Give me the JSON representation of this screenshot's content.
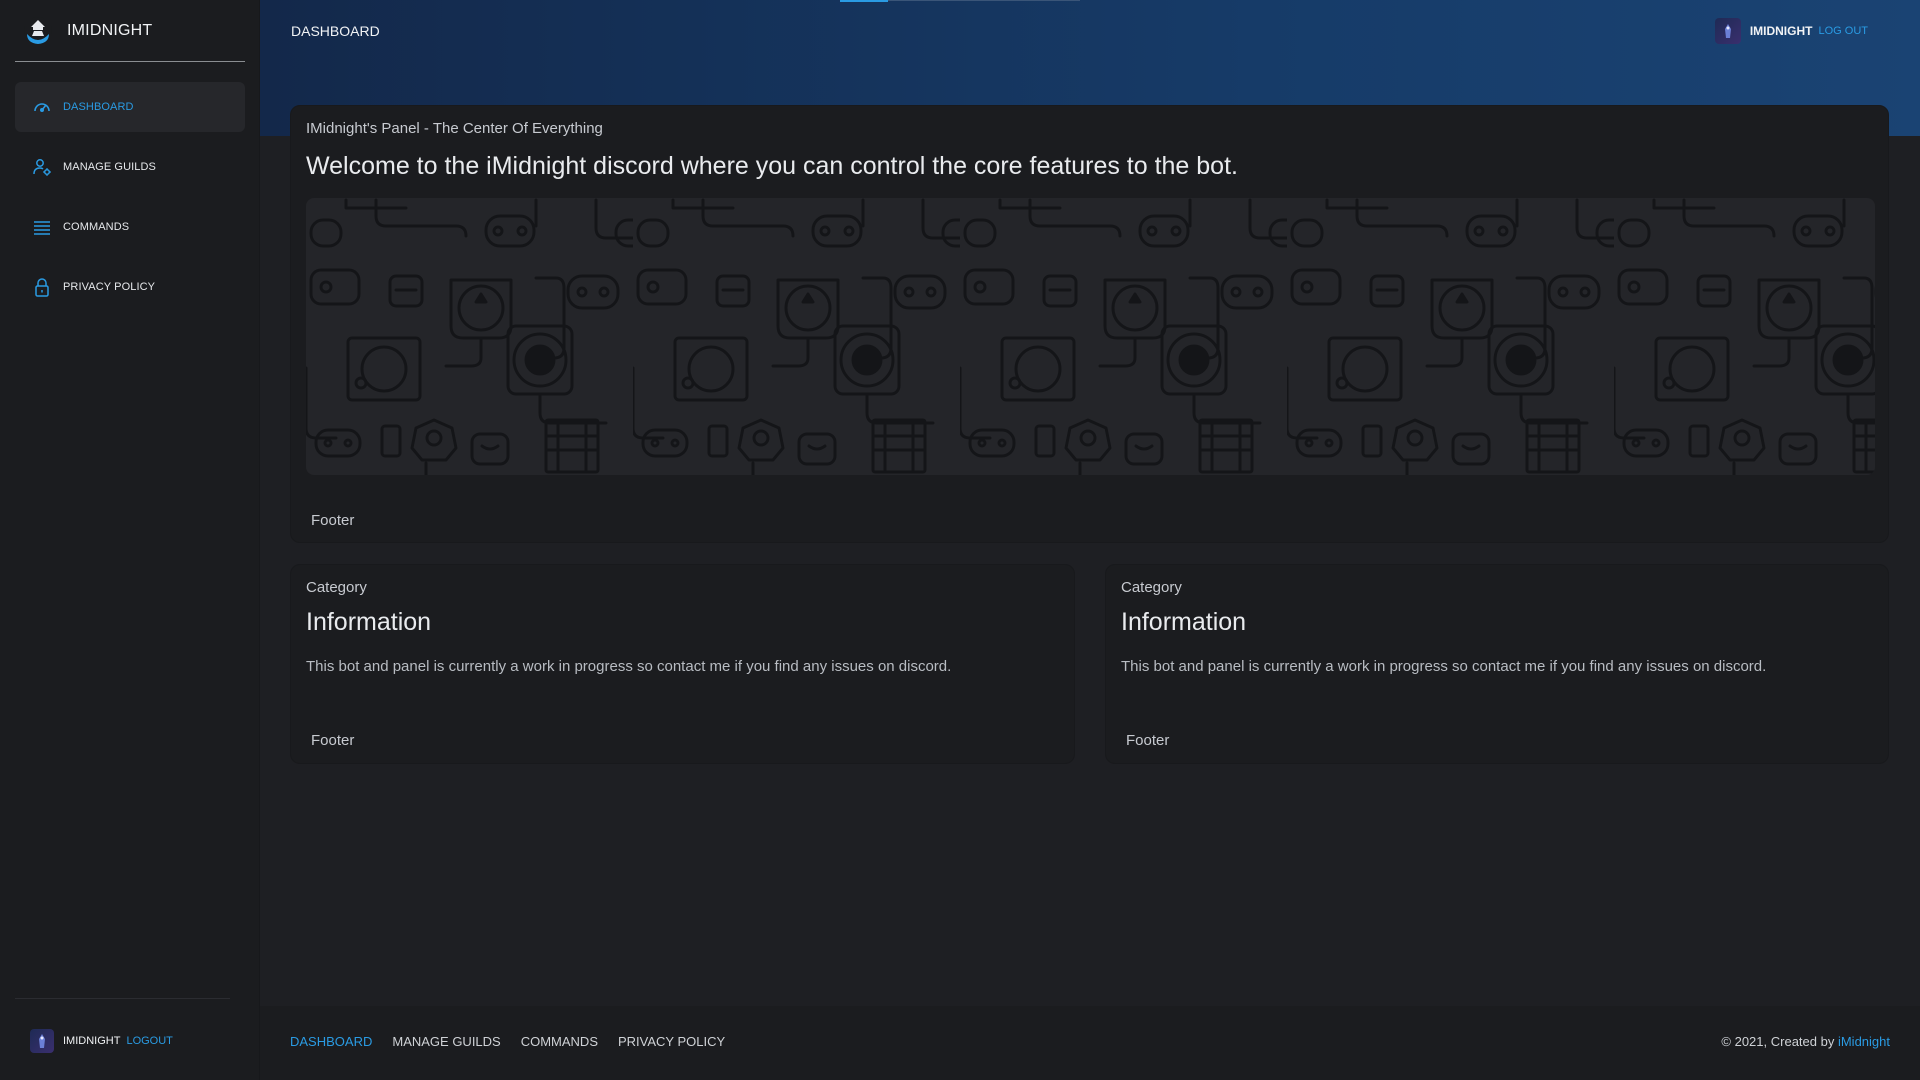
{
  "brand": {
    "name": "IMIDNIGHT"
  },
  "sidebar": {
    "items": [
      {
        "label": "DASHBOARD",
        "icon": "speedometer-icon",
        "active": true
      },
      {
        "label": "MANAGE GUILDS",
        "icon": "user-gear-icon"
      },
      {
        "label": "COMMANDS",
        "icon": "list-icon"
      },
      {
        "label": "PRIVACY POLICY",
        "icon": "lock-icon"
      }
    ],
    "user": {
      "name": "IMIDNIGHT",
      "logout": "LOGOUT"
    }
  },
  "header": {
    "title": "DASHBOARD",
    "user": {
      "name": "IMIDNIGHT",
      "logout": "LOG OUT"
    }
  },
  "main_card": {
    "kicker": "IMidnight's Panel - The Center Of Everything",
    "title": "Welcome to the iMidnight discord where you can control the core features to the bot.",
    "footer": "Footer"
  },
  "info_cards": [
    {
      "kicker": "Category",
      "title": "Information",
      "text": "This bot and panel is currently a work in progress so contact me if you find any issues on discord.",
      "footer": "Footer"
    },
    {
      "kicker": "Category",
      "title": "Information",
      "text": "This bot and panel is currently a work in progress so contact me if you find any issues on discord.",
      "footer": "Footer"
    }
  ],
  "footer": {
    "links": [
      "DASHBOARD",
      "MANAGE GUILDS",
      "COMMANDS",
      "PRIVACY POLICY"
    ],
    "copyright": "© 2021, Created by",
    "author": "iMidnight"
  },
  "colors": {
    "accent": "#2a9be3",
    "background": "#1e1f23",
    "panel": "#1b1c1f",
    "header_start": "#13284a",
    "header_end": "#1a4373"
  }
}
